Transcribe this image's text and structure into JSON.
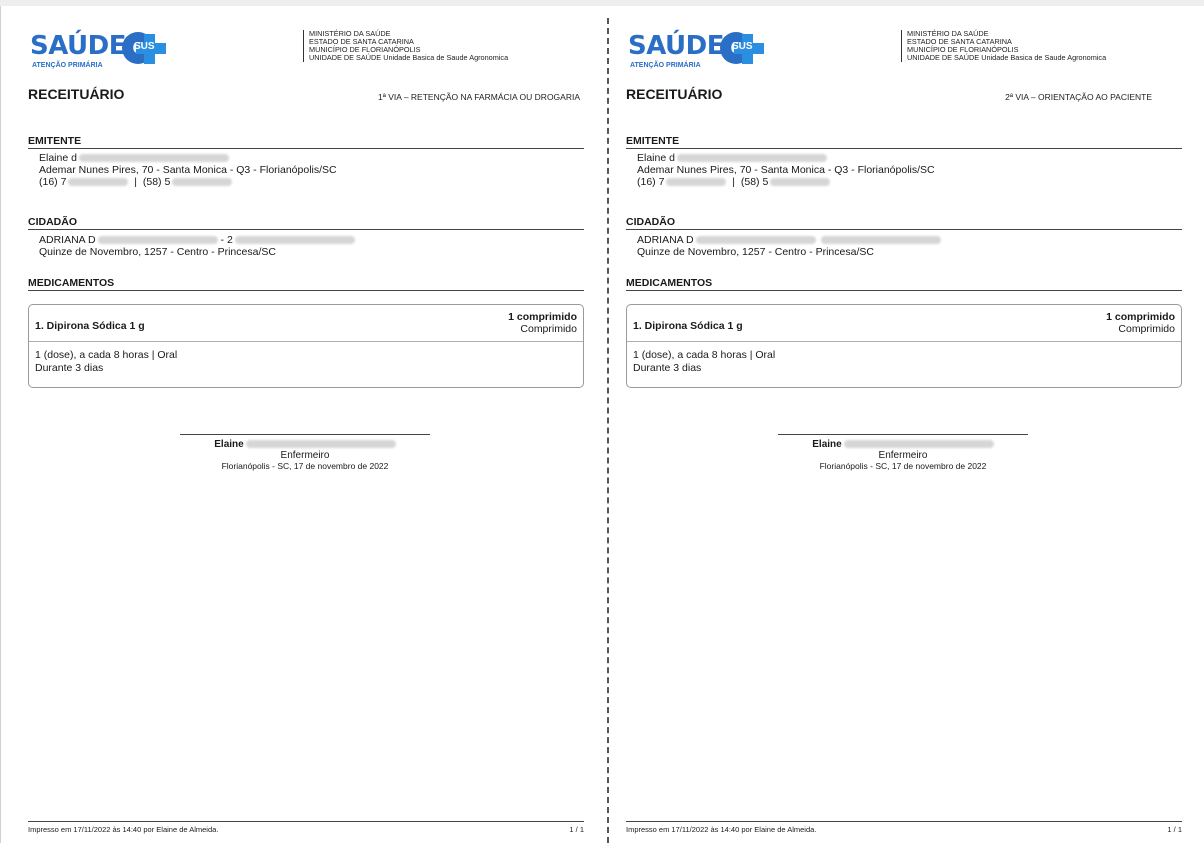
{
  "logo": {
    "brand": "SAÚDE",
    "badge": "e",
    "sus": "SUS",
    "subtitle": "ATENÇÃO PRIMÁRIA"
  },
  "institution": [
    "MINISTÉRIO DA SAÚDE",
    "ESTADO DE SANTA CATARINA",
    "MUNICÍPIO DE FLORIANÓPOLIS",
    "UNIDADE DE SAÚDE Unidade Basica de Saude Agronomica"
  ],
  "document_title": "RECEITUÁRIO",
  "via_left": "1ª VIA – RETENÇÃO NA FARMÁCIA OU DROGARIA",
  "via_right": "2ª VIA – ORIENTAÇÃO AO PACIENTE",
  "emitente": {
    "heading": "EMITENTE",
    "name": "Elaine d",
    "address": "Ademar Nunes Pires, 70 - Santa Monica - Q3 - Florianópolis/SC",
    "phone1": "(16) 7",
    "phone_sep": "|",
    "phone2": "(58) 5"
  },
  "cidadao": {
    "heading": "CIDADÃO",
    "name": "ADRIANA D",
    "name_suffix": "- 2",
    "address": "Quinze de Novembro, 1257 - Centro - Princesa/SC"
  },
  "medicamentos": {
    "heading": "MEDICAMENTOS",
    "item_name": "1. Dipirona Sódica 1 g",
    "quantity": "1 comprimido",
    "unit": "Comprimido",
    "dose": "1 (dose), a cada 8 horas | Oral",
    "duration": "Durante 3 dias"
  },
  "signature": {
    "name": "Elaine",
    "role": "Enfermeiro",
    "place_date": "Florianópolis - SC, 17 de novembro de 2022"
  },
  "footer": {
    "printed": "Impresso em 17/11/2022 às 14:40 por Elaine de Almeida.",
    "page": "1 / 1"
  }
}
